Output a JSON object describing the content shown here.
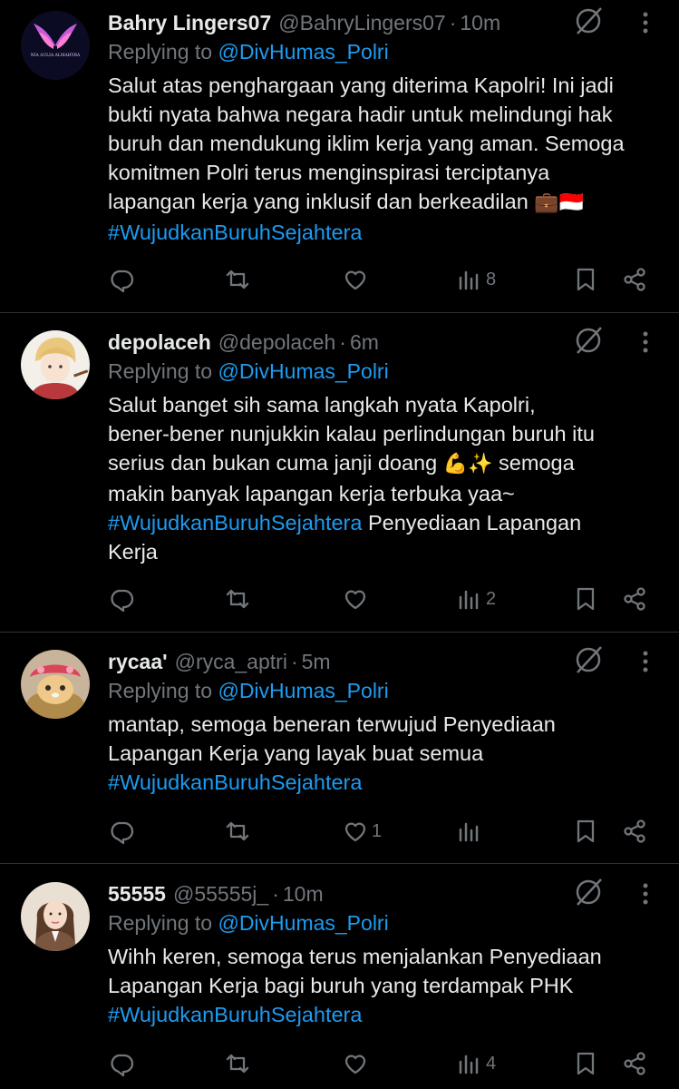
{
  "tweets": [
    {
      "name": "Bahry Lingers07",
      "handle": "@BahryLingers07",
      "time": "10m",
      "replying_label": "Replying to",
      "replying_to": "@DivHumas_Polri",
      "body": "Salut atas penghargaan yang diterima Kapolri! Ini jadi\nbukti nyata bahwa negara hadir untuk melindungi hak\nburuh dan mendukung iklim kerja yang aman. Semoga\nkomitmen Polri terus menginspirasi terciptanya\nlapangan kerja yang inklusif dan berkeadilan ",
      "emoji": "💼🇮🇩",
      "hashtag": "#WujudkanBuruhSejahtera",
      "trailing": "",
      "avatar_text": "NIA AULIA ALMAHYRA",
      "likes": "",
      "views": "8"
    },
    {
      "name": "depolaceh",
      "handle": "@depolaceh",
      "time": "6m",
      "replying_label": "Replying to",
      "replying_to": "@DivHumas_Polri",
      "body": "Salut banget sih sama langkah nyata Kapolri,\nbener-bener nunjukkin kalau perlindungan buruh itu\nserius dan bukan cuma janji doang ",
      "emoji": "💪✨",
      "body2": " semoga\nmakin banyak lapangan kerja terbuka yaa~\n",
      "hashtag": "#WujudkanBuruhSejahtera",
      "trailing": " Penyediaan Lapangan\nKerja",
      "likes": "",
      "views": "2"
    },
    {
      "name": "rycaa'",
      "handle": "@ryca_aptri",
      "time": "5m",
      "replying_label": "Replying to",
      "replying_to": "@DivHumas_Polri",
      "body": "mantap, semoga beneran terwujud Penyediaan\nLapangan Kerja yang layak buat semua\n",
      "hashtag": "#WujudkanBuruhSejahtera",
      "trailing": "",
      "likes": "1",
      "views": ""
    },
    {
      "name": "55555",
      "handle": "@55555j_",
      "time": "10m",
      "replying_label": "Replying to",
      "replying_to": "@DivHumas_Polri",
      "body": "Wihh keren, semoga terus menjalankan Penyediaan\nLapangan Kerja bagi buruh yang terdampak PHK\n",
      "hashtag": "#WujudkanBuruhSejahtera",
      "trailing": "",
      "likes": "",
      "views": "4"
    }
  ],
  "dot": "·",
  "colors": {
    "background": "#000000",
    "text": "#e7e9ea",
    "muted": "#71767b",
    "link": "#1d9bf0",
    "divider": "#2f3336"
  },
  "icons": [
    "reply-icon",
    "retweet-icon",
    "like-icon",
    "views-icon",
    "bookmark-icon",
    "share-icon",
    "grok-icon",
    "more-icon"
  ]
}
